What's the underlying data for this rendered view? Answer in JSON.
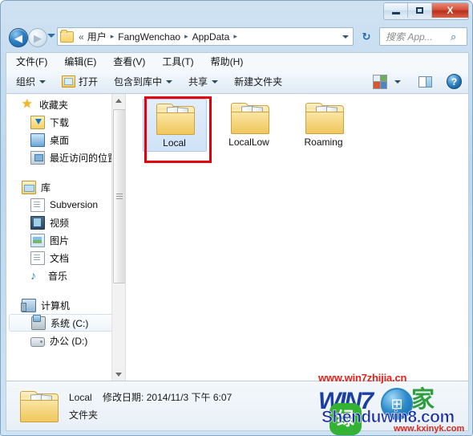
{
  "window": {
    "controls": {
      "minimize_label": "–",
      "maximize_label": "□",
      "close_label": "X"
    }
  },
  "address_bar": {
    "back_label": "◀",
    "forward_label": "▶",
    "history_label": "▾",
    "folder_chevron": "«",
    "segments": [
      "用户",
      "FangWenchao",
      "AppData"
    ],
    "separator": "▸",
    "dropdown_label": "▾",
    "refresh_label": "↻",
    "search_placeholder": "搜索 App...",
    "search_icon": "⌕"
  },
  "menubar": {
    "items": [
      {
        "label": "文件(F)"
      },
      {
        "label": "编辑(E)"
      },
      {
        "label": "查看(V)"
      },
      {
        "label": "工具(T)"
      },
      {
        "label": "帮助(H)"
      }
    ]
  },
  "toolbar": {
    "organize_label": "组织",
    "open_label": "打开",
    "include_in_library_label": "包含到库中",
    "share_label": "共享",
    "new_folder_label": "新建文件夹",
    "caret": "▾",
    "help_label": "?"
  },
  "sidebar": {
    "groups": [
      {
        "root": {
          "label": "收藏夹",
          "icon": "star-icon"
        },
        "children": [
          {
            "label": "下载",
            "icon": "download-icon"
          },
          {
            "label": "桌面",
            "icon": "desktop-icon"
          },
          {
            "label": "最近访问的位置",
            "icon": "recent-places-icon"
          }
        ]
      },
      {
        "root": {
          "label": "库",
          "icon": "library-icon"
        },
        "children": [
          {
            "label": "Subversion",
            "icon": "document-icon"
          },
          {
            "label": "视频",
            "icon": "video-icon"
          },
          {
            "label": "图片",
            "icon": "picture-icon"
          },
          {
            "label": "文档",
            "icon": "document-icon"
          },
          {
            "label": "音乐",
            "icon": "music-icon"
          }
        ]
      },
      {
        "root": {
          "label": "计算机",
          "icon": "computer-icon"
        },
        "children": [
          {
            "label": "系统 (C:)",
            "icon": "system-drive-icon",
            "selected": true
          },
          {
            "label": "办公 (D:)",
            "icon": "drive-icon",
            "selected": false
          }
        ]
      }
    ]
  },
  "files": [
    {
      "name": "Local",
      "type": "folder",
      "selected": true,
      "highlighted": true
    },
    {
      "name": "LocalLow",
      "type": "folder",
      "selected": false,
      "highlighted": false
    },
    {
      "name": "Roaming",
      "type": "folder",
      "selected": false,
      "highlighted": false
    }
  ],
  "status": {
    "name": "Local",
    "modified_label": "修改日期:",
    "modified_value": "2014/11/3 下午 6:07",
    "type": "文件夹"
  },
  "watermarks": {
    "url_top": "www.win7zhijia.cn",
    "logo_win7": "WIN7",
    "logo_cn": "家",
    "logo_orb": "⊞",
    "green_badge": "绿",
    "shenduwin8": "Shenduwin8.com",
    "kxinyk": "www.kxinyk.com"
  },
  "colors": {
    "highlight_red": "#e3000b",
    "watermark_red": "#e2231a",
    "selection_blue": "#cfe2f7",
    "accent_blue": "#2a7fc4",
    "folder_yellow": "#f4d277"
  }
}
